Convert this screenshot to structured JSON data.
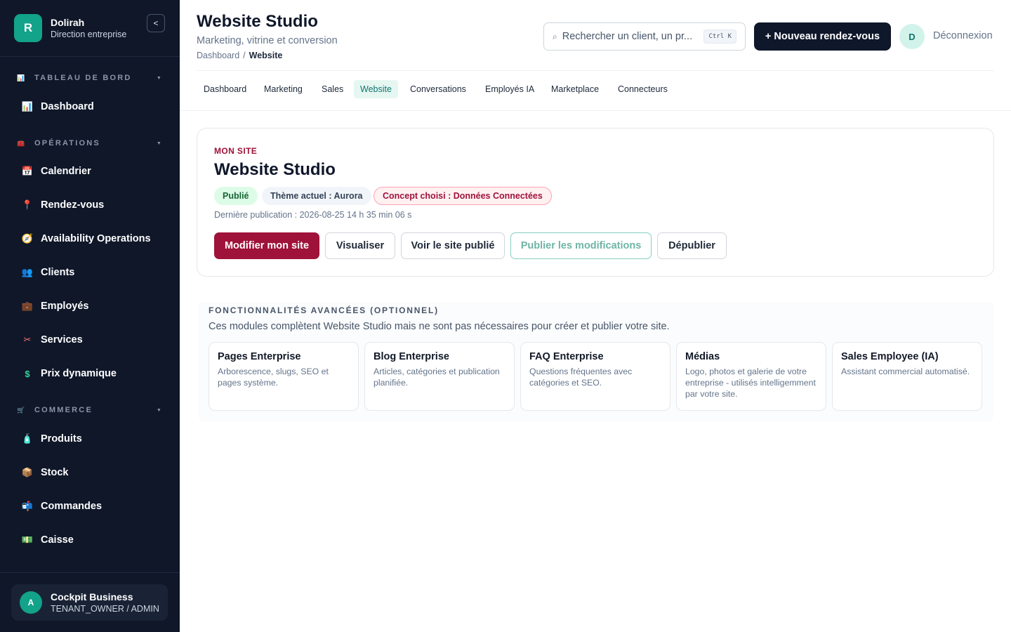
{
  "sidebar": {
    "brand": {
      "logo_letter": "R",
      "name": "Dolirah",
      "subtitle": "Direction entreprise",
      "collapse_glyph": "<"
    },
    "sections": [
      {
        "icon": "📊",
        "icon_name": "chart-icon",
        "title": "TABLEAU DE BORD",
        "items": [
          {
            "icon": "📊",
            "icon_name": "chart-icon",
            "label": "Dashboard"
          }
        ]
      },
      {
        "icon": "🧰",
        "icon_name": "toolbox-icon",
        "title": "OPÉRATIONS",
        "items": [
          {
            "icon": "📅",
            "icon_name": "calendar-icon",
            "label": "Calendrier"
          },
          {
            "icon": "📍",
            "icon_name": "pin-icon",
            "label": "Rendez-vous"
          },
          {
            "icon": "🧭",
            "icon_name": "compass-icon",
            "label": "Availability Operations"
          },
          {
            "icon": "👥",
            "icon_name": "users-icon",
            "label": "Clients"
          },
          {
            "icon": "💼",
            "icon_name": "briefcase-icon",
            "label": "Employés"
          },
          {
            "icon": "✂",
            "icon_name": "scissors-icon",
            "label": "Services"
          },
          {
            "icon": "$",
            "icon_name": "dollar-icon",
            "label": "Prix dynamique"
          }
        ]
      },
      {
        "icon": "🛒",
        "icon_name": "cart-icon",
        "title": "COMMERCE",
        "items": [
          {
            "icon": "🧴",
            "icon_name": "product-icon",
            "label": "Produits"
          },
          {
            "icon": "📦",
            "icon_name": "box-icon",
            "label": "Stock"
          },
          {
            "icon": "📬",
            "icon_name": "mailbox-icon",
            "label": "Commandes"
          },
          {
            "icon": "💵",
            "icon_name": "cash-icon",
            "label": "Caisse"
          }
        ]
      }
    ],
    "caret_glyph": "▼",
    "footer": {
      "avatar_letter": "A",
      "name": "Cockpit Business",
      "role": "TENANT_OWNER / ADMIN"
    }
  },
  "header": {
    "title": "Website Studio",
    "subtitle": "Marketing, vitrine et conversion",
    "breadcrumb": {
      "root": "Dashboard",
      "separator": "/",
      "current": "Website"
    },
    "search": {
      "icon": "⌕",
      "placeholder": "Rechercher un client, un pr...",
      "shortcut": "Ctrl K"
    },
    "new_button": "+ Nouveau rendez-vous",
    "user_avatar": "D",
    "logout": "Déconnexion"
  },
  "tabs": [
    {
      "label": "Dashboard",
      "active": false
    },
    {
      "label": "Marketing",
      "active": false
    },
    {
      "label": "Sales",
      "active": false
    },
    {
      "label": "Website",
      "active": true
    },
    {
      "label": "Conversations",
      "active": false
    },
    {
      "label": "Employés IA",
      "active": false
    },
    {
      "label": "Marketplace",
      "active": false
    },
    {
      "label": "Connecteurs",
      "active": false
    }
  ],
  "site": {
    "eyebrow": "MON SITE",
    "title": "Website Studio",
    "badges": {
      "status": "Publié",
      "theme": "Thème actuel : Aurora",
      "concept": "Concept choisi : Données Connectées"
    },
    "last_published": "Dernière publication : 2026-08-25 14 h 35 min 06 s",
    "buttons": {
      "edit": "Modifier mon site",
      "preview": "Visualiser",
      "view_published": "Voir le site publié",
      "publish": "Publier les modifications",
      "unpublish": "Dépublier"
    }
  },
  "advanced": {
    "title": "FONCTIONNALITÉS AVANCÉES (OPTIONNEL)",
    "subtitle": "Ces modules complètent Website Studio mais ne sont pas nécessaires pour créer et publier votre site.",
    "modules": [
      {
        "title": "Pages Enterprise",
        "desc": "Arborescence, slugs, SEO et pages système."
      },
      {
        "title": "Blog Enterprise",
        "desc": "Articles, catégories et publication planifiée."
      },
      {
        "title": "FAQ Enterprise",
        "desc": "Questions fréquentes avec catégories et SEO."
      },
      {
        "title": "Médias",
        "desc": "Logo, photos et galerie de votre entreprise - utilisés intelligemment par votre site."
      },
      {
        "title": "Sales Employee (IA)",
        "desc": "Assistant commercial automatisé."
      }
    ]
  },
  "colors": {
    "sidebar_bg": "#0f1729",
    "brand_accent": "#12a38a",
    "primary_action": "#9f1239",
    "dark_button": "#0f172a",
    "active_tab_bg": "#e6f7f2"
  }
}
